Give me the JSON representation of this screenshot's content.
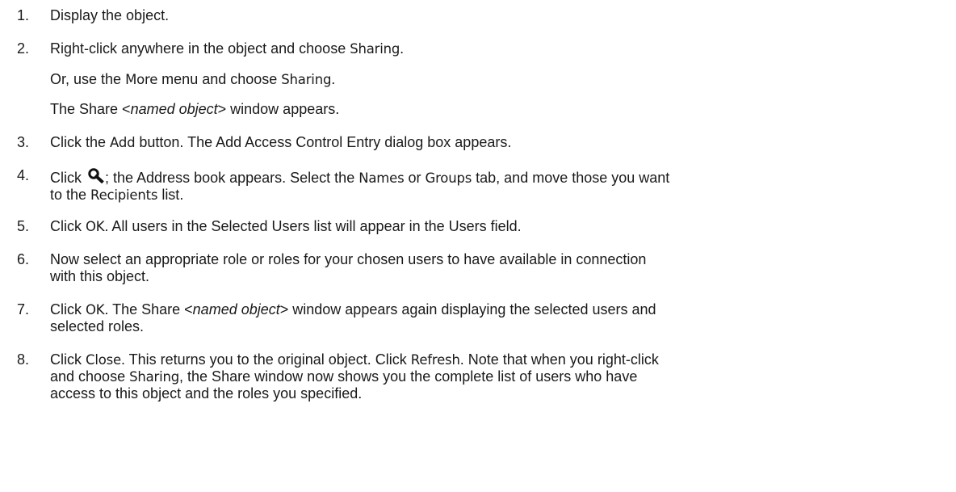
{
  "steps": [
    {
      "number": "1.",
      "text": "Display the object."
    },
    {
      "number": "2.",
      "pre": "Right-click anywhere in the object and choose ",
      "ui": "Sharing",
      "post": "."
    },
    {
      "sub1_pre": "Or, use the ",
      "sub1_ui1": "More",
      "sub1_mid": " menu and choose ",
      "sub1_ui2": "Sharing",
      "sub1_post": "."
    },
    {
      "sub2_pre": "The Share <",
      "sub2_em": "named object",
      "sub2_post": "> window appears."
    },
    {
      "number": "3.",
      "pre": "Click the ",
      "ui": "Add",
      "post": " button. The Add Access Control Entry dialog box appears."
    },
    {
      "number": "4.",
      "pre": "Click ",
      "post1": "; the Address book appears. Select the ",
      "ui1": "Names",
      "mid": " or ",
      "ui2": "Groups",
      "post2": " tab, and move those you want",
      "line2_pre": "to the ",
      "line2_ui": "Recipients",
      "line2_post": " list."
    },
    {
      "number": "5.",
      "pre": "Click ",
      "ui": "OK",
      "post": ". All users in the Selected Users list will appear in the Users field."
    },
    {
      "number": "6.",
      "line1": "Now select an appropriate role or roles for your chosen users to have available in connection",
      "line2": "with this object."
    },
    {
      "number": "7.",
      "pre": "Click ",
      "ui": "OK",
      "mid": ". The Share <",
      "em": "named object",
      "post": "> window appears again displaying the selected users and",
      "line2": "selected roles."
    },
    {
      "number": "8.",
      "pre": "Click ",
      "ui1": "Close",
      "mid1": ". This returns you to the original object. Click ",
      "ui2": "Refresh",
      "post1": ". Note that when you right-click",
      "line2_pre": "and choose ",
      "line2_ui": "Sharing",
      "line2_post": ", the Share window now shows you the complete list of users who have",
      "line3": "access to this object and the roles you specified."
    }
  ],
  "icons": {
    "address_book_search": "magnifier-icon"
  }
}
